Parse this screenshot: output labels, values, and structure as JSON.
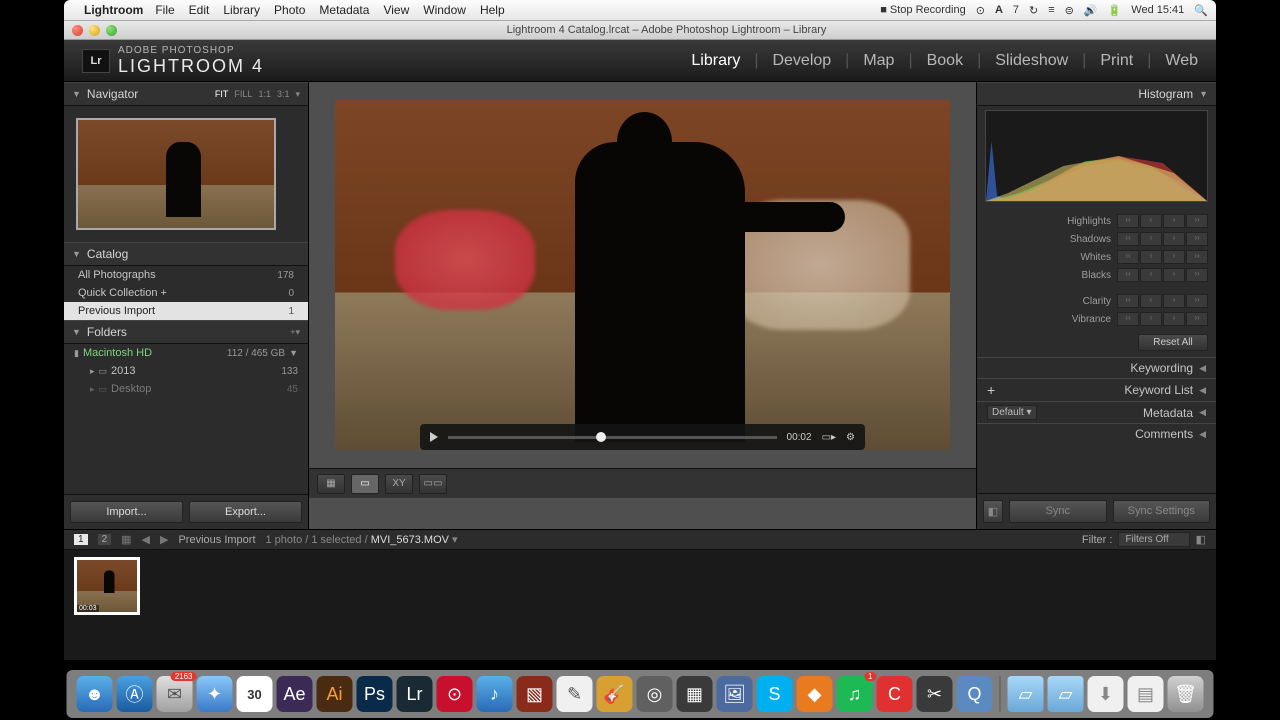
{
  "mac": {
    "app": "Lightroom",
    "menus": [
      "File",
      "Edit",
      "Library",
      "Photo",
      "Metadata",
      "View",
      "Window",
      "Help"
    ],
    "stop_rec": "Stop Recording",
    "clock": "Wed 15:41"
  },
  "title": "Lightroom 4 Catalog.lrcat – Adobe Photoshop Lightroom – Library",
  "brand": {
    "small": "ADOBE PHOTOSHOP",
    "big": "LIGHTROOM 4",
    "logo": "Lr"
  },
  "modules": [
    "Library",
    "Develop",
    "Map",
    "Book",
    "Slideshow",
    "Print",
    "Web"
  ],
  "active_module": "Library",
  "navigator": {
    "title": "Navigator",
    "fit": "FIT",
    "fill": "FILL",
    "r11": "1:1",
    "r31": "3:1"
  },
  "catalog": {
    "title": "Catalog",
    "rows": [
      {
        "label": "All Photographs",
        "count": "178"
      },
      {
        "label": "Quick Collection  +",
        "count": "0"
      },
      {
        "label": "Previous Import",
        "count": "1"
      }
    ]
  },
  "folders": {
    "title": "Folders",
    "hd": "Macintosh HD",
    "hd_size": "112 / 465 GB",
    "sub": [
      {
        "label": "2013",
        "count": "133"
      },
      {
        "label": "Desktop",
        "count": "45"
      }
    ]
  },
  "buttons": {
    "import": "Import...",
    "export": "Export..."
  },
  "video": {
    "time": "00:02"
  },
  "histogram": {
    "title": "Histogram"
  },
  "adjust": {
    "rows": [
      "Highlights",
      "Shadows",
      "Whites",
      "Blacks",
      "Clarity",
      "Vibrance"
    ],
    "reset": "Reset All"
  },
  "rpanels": {
    "keywording": "Keywording",
    "keywordlist": "Keyword List",
    "metadata": "Metadata",
    "comments": "Comments",
    "meta_sel": "Default"
  },
  "sync": {
    "sync": "Sync",
    "settings": "Sync Settings"
  },
  "filmstrip": {
    "source": "Previous Import",
    "stats": "1 photo / 1 selected /",
    "filename": "MVI_5673.MOV",
    "filter_label": "Filter :",
    "filter_sel": "Filters Off",
    "thumb_time": "00:03"
  }
}
